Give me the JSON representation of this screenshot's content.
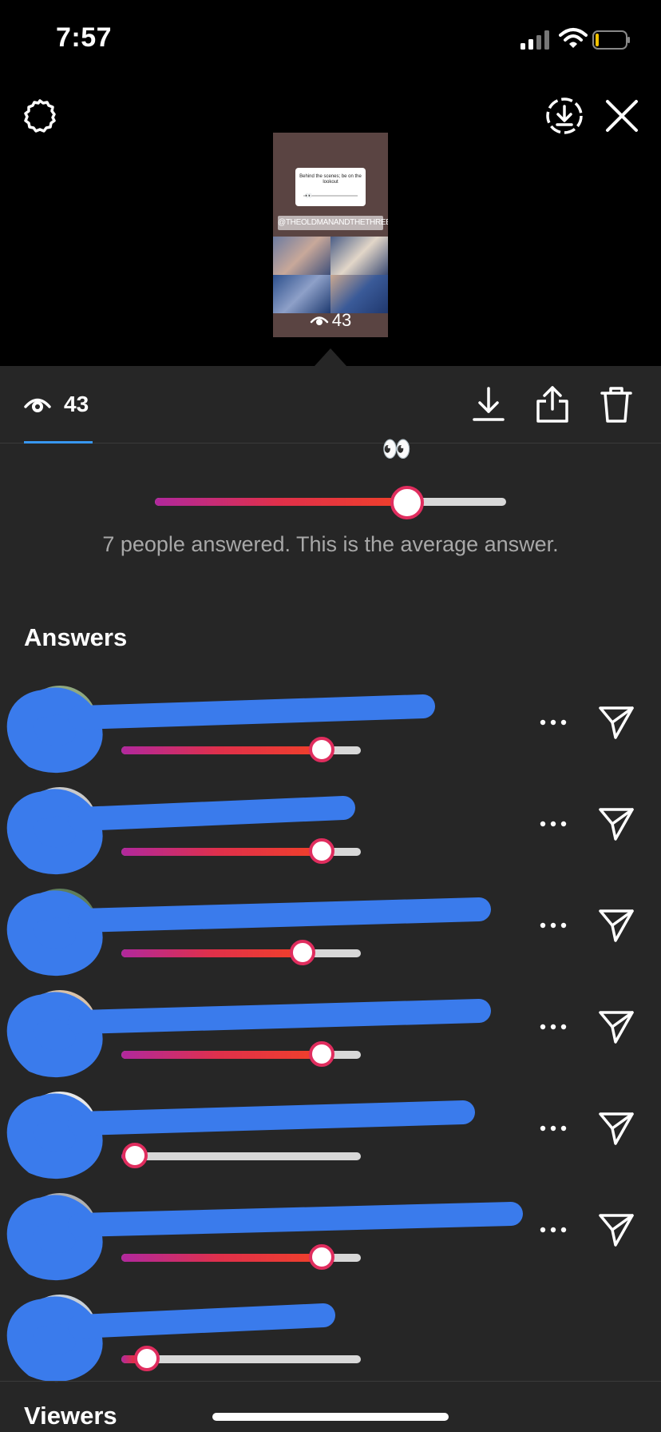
{
  "status_bar": {
    "time": "7:57"
  },
  "icons": {
    "settings": "gear-icon",
    "download_story": "download-circle-icon",
    "close": "close-icon",
    "eye": "eye-icon",
    "download": "download-icon",
    "share": "share-icon",
    "delete": "trash-icon",
    "more": "more-icon",
    "send": "send-icon"
  },
  "story_preview": {
    "question": "Behind the scenes; be on the lookout",
    "mention": "@THEOLDMANANDTHETHREE",
    "views": "43"
  },
  "toolbar": {
    "view_count": "43"
  },
  "poll": {
    "emoji": "👀",
    "average_fraction": 0.71,
    "summary": "7 people answered. This is the average answer."
  },
  "answers": {
    "title": "Answers",
    "items": [
      {
        "fraction": 0.83
      },
      {
        "fraction": 0.83
      },
      {
        "fraction": 0.75
      },
      {
        "fraction": 0.83
      },
      {
        "fraction": 0.05
      },
      {
        "fraction": 0.83
      },
      {
        "fraction": 0.1
      }
    ]
  },
  "viewers": {
    "title": "Viewers"
  },
  "colors": {
    "accent_gradient_start": "#b1289d",
    "accent_gradient_end": "#f0402a",
    "knob_border": "#e02d5e",
    "scribble": "#3a7bec",
    "sheet_background": "#262626"
  }
}
